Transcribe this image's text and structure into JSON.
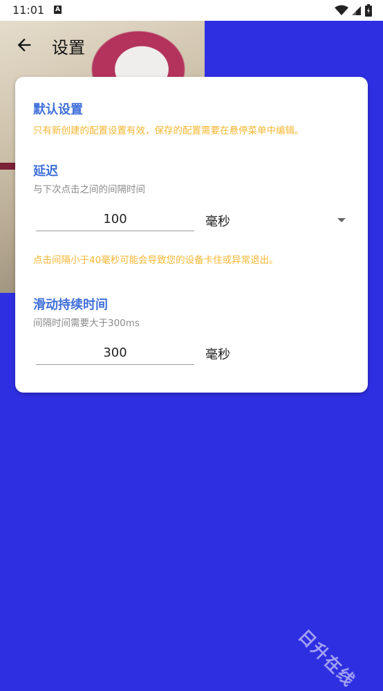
{
  "status_bar": {
    "time": "11:01",
    "notification_icon": "a-icon",
    "icons": [
      "wifi-icon",
      "signal-icon",
      "battery-icon"
    ]
  },
  "toolbar": {
    "title": "设置",
    "back_icon": "arrow-left-icon"
  },
  "card": {
    "default_section": {
      "title": "默认设置",
      "note": "只有新创建的配置设置有效，保存的配置需要在悬停菜单中编辑。"
    },
    "delay_section": {
      "title": "延迟",
      "subtitle": "与下次点击之间的间隔时间",
      "value": "100",
      "unit": "毫秒",
      "warning": "点击间隔小于40毫秒可能会导致您的设备卡住或异常退出。"
    },
    "swipe_section": {
      "title": "滑动持续时间",
      "subtitle": "间隔时间需要大于300ms",
      "value": "300",
      "unit": "毫秒"
    }
  },
  "watermark": "日升在线",
  "colors": {
    "background": "#2f2fe2",
    "accent": "#3f6fd9",
    "warning": "#f5b631",
    "hint": "#8a8a8a"
  }
}
